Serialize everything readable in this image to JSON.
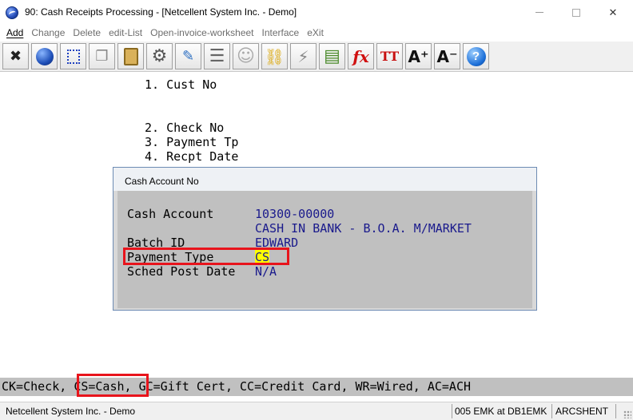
{
  "window": {
    "title": "90: Cash Receipts Processing - [Netcellent System Inc. - Demo]",
    "min_glyph": "—",
    "close_glyph": "✕"
  },
  "menu": [
    {
      "label": "Add",
      "enabled": true
    },
    {
      "label": "Change",
      "enabled": false
    },
    {
      "label": "Delete",
      "enabled": false
    },
    {
      "label": "edit-List",
      "enabled": false
    },
    {
      "label": "Open-invoice-worksheet",
      "enabled": false
    },
    {
      "label": "Interface",
      "enabled": false
    },
    {
      "label": "eXit",
      "enabled": false
    }
  ],
  "toolbar": [
    {
      "icon": "close-x-icon",
      "glyph": "✖",
      "color": "#222222"
    },
    {
      "icon": "globe-icon",
      "glyph": "●",
      "color": "#1e4fb8"
    },
    {
      "icon": "select-box-icon",
      "glyph": "⬚",
      "color": "#1d3fbf"
    },
    {
      "icon": "copy-icon",
      "glyph": "❐",
      "color": "#888888"
    },
    {
      "icon": "paste-icon",
      "glyph": "📋",
      "color": "#b8862b"
    },
    {
      "icon": "settings-icon",
      "glyph": "⚙",
      "color": "#666666"
    },
    {
      "icon": "edit-window-icon",
      "glyph": "✎",
      "color": "#2d6fc2"
    },
    {
      "icon": "list-icon",
      "glyph": "☰",
      "color": "#777777"
    },
    {
      "icon": "users-icon",
      "glyph": "☺",
      "color": "#aaaaaa"
    },
    {
      "icon": "chain-link-icon",
      "glyph": "⛓",
      "color": "#d9a400"
    },
    {
      "icon": "lightning-icon",
      "glyph": "⚡",
      "color": "#888888"
    },
    {
      "icon": "form-icon",
      "glyph": "▤",
      "color": "#4a8a2a"
    },
    {
      "icon": "function-fx-icon",
      "glyph": "fx",
      "color": "#d01010"
    },
    {
      "icon": "text-size-icon",
      "glyph": "TT",
      "color": "#c81010"
    },
    {
      "icon": "font-increase-icon",
      "glyph": "A⁺",
      "color": "#111111"
    },
    {
      "icon": "font-decrease-icon",
      "glyph": "A⁻",
      "color": "#111111"
    },
    {
      "icon": "help-icon",
      "glyph": "?",
      "color": "#ffffff"
    }
  ],
  "form": {
    "field1": "1. Cust No",
    "field2": "2. Check No",
    "field3": "3. Payment Tp",
    "field4": "4. Recpt Date"
  },
  "dialog": {
    "title": "Cash Account No",
    "rows": [
      {
        "label": "Cash Account",
        "value": "10300-00000"
      },
      {
        "label": "",
        "value": "CASH IN BANK - B.O.A. M/MARKET"
      },
      {
        "label": "Batch ID",
        "value": "EDWARD"
      },
      {
        "label": "Payment Type",
        "value": "CS"
      },
      {
        "label": "Sched Post Date",
        "value": "N/A"
      }
    ]
  },
  "hint": {
    "before": "CK=Check, ",
    "highlighted": "CS=Cash,",
    "after": " GC=Gift Cert, CC=Credit Card, WR=Wired, AC=ACH"
  },
  "status": {
    "company": "Netcellent System Inc. - Demo",
    "session": "005 EMK at DB1EMK",
    "app": "ARCSHENT"
  },
  "colors": {
    "highlight_box": "#e8141c",
    "value_text": "#1a1a8c",
    "cs_background": "#ffff00"
  }
}
